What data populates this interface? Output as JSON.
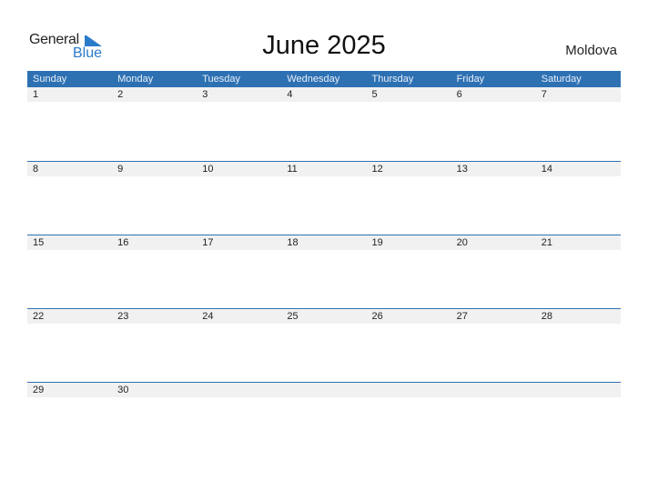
{
  "logo": {
    "word1": "General",
    "word2": "Blue"
  },
  "title": "June 2025",
  "country": "Moldova",
  "colors": {
    "header": "#2e71b3",
    "strip": "#f1f1f1",
    "logo_blue": "#2a7bc9"
  },
  "weekdays": [
    "Sunday",
    "Monday",
    "Tuesday",
    "Wednesday",
    "Thursday",
    "Friday",
    "Saturday"
  ],
  "weeks": [
    [
      "1",
      "2",
      "3",
      "4",
      "5",
      "6",
      "7"
    ],
    [
      "8",
      "9",
      "10",
      "11",
      "12",
      "13",
      "14"
    ],
    [
      "15",
      "16",
      "17",
      "18",
      "19",
      "20",
      "21"
    ],
    [
      "22",
      "23",
      "24",
      "25",
      "26",
      "27",
      "28"
    ],
    [
      "29",
      "30",
      "",
      "",
      "",
      "",
      ""
    ]
  ]
}
